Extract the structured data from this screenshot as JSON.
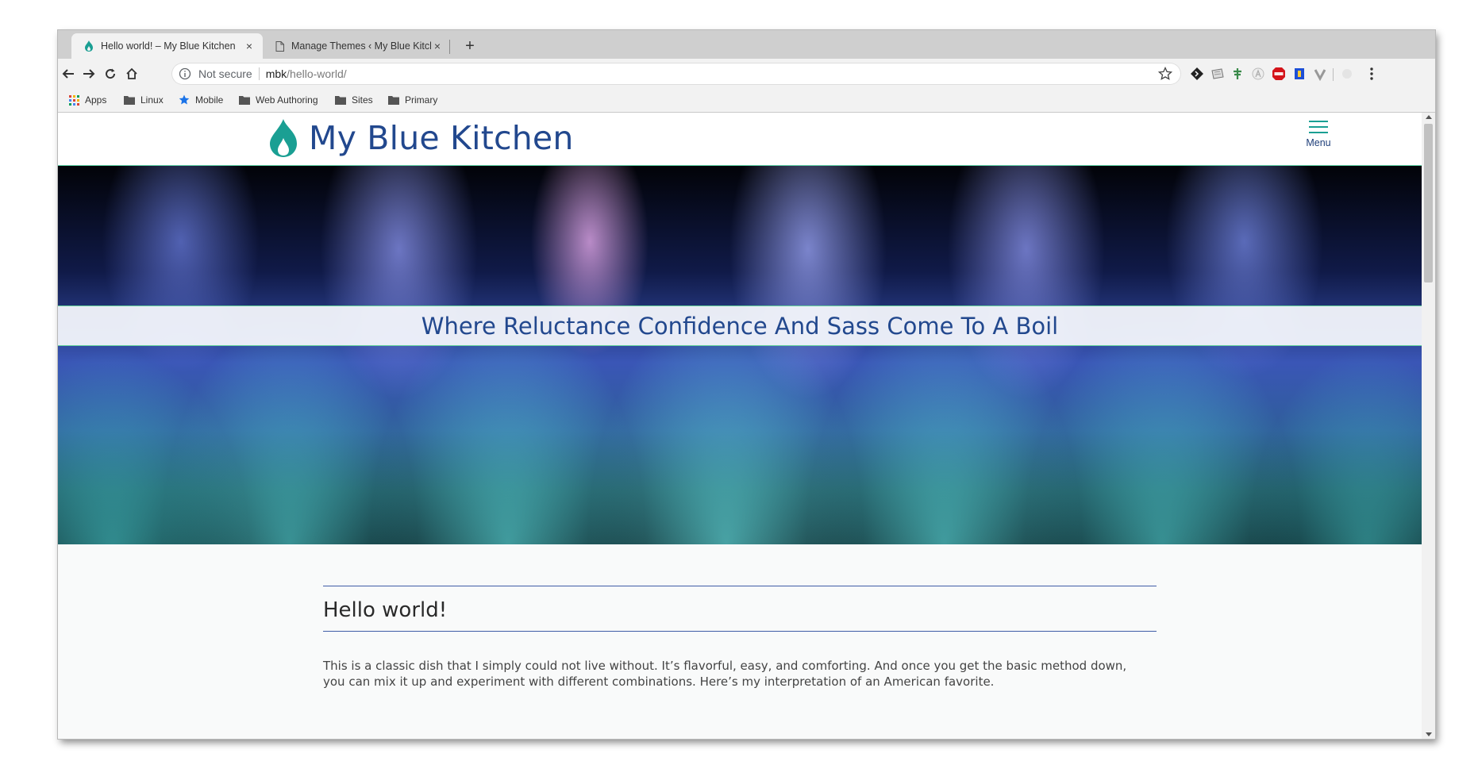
{
  "browser": {
    "tabs": [
      {
        "title": "Hello world! – My Blue Kitchen",
        "close": "×",
        "icon": "flame-icon"
      },
      {
        "title": "Manage Themes ‹ My Blue Kitchen",
        "close": "×",
        "icon": "page-icon"
      }
    ],
    "new_tab": "+",
    "address": {
      "security": "Not secure",
      "host": "mbk",
      "path": "/hello-world/"
    },
    "bookmarks": [
      "Apps",
      "Linux",
      "Mobile",
      "Web Authoring",
      "Sites",
      "Primary"
    ]
  },
  "site": {
    "title": "My Blue Kitchen",
    "menu_label": "Menu",
    "tagline": "Where Reluctance Confidence And Sass Come To A Boil"
  },
  "post": {
    "title": "Hello world!",
    "body": "This is a classic dish that I simply could not live without.  It’s flavorful, easy, and comforting.  And once you get the basic method down, you can mix it up and experiment with different combinations.  Here’s my interpretation of an American favorite."
  },
  "colors": {
    "brand": "#22488e",
    "accent": "#1a9f93",
    "rule": "#3f5ca6"
  }
}
